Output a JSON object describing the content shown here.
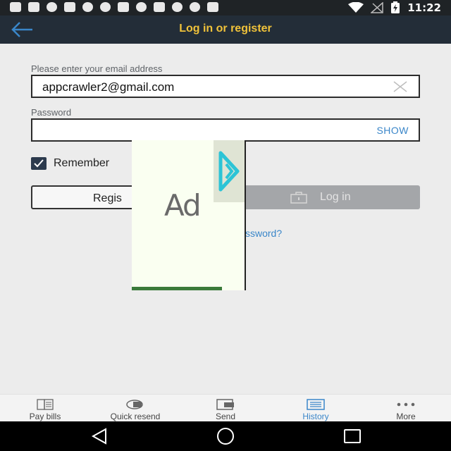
{
  "status_bar": {
    "time": "11:22",
    "notification_icons": [
      "chat-bubble-icon",
      "bat-icon",
      "link-icon",
      "bat-icon",
      "link-icon",
      "link-icon",
      "bat-icon",
      "b-bubble-icon",
      "mail-icon",
      "pinterest-icon",
      "cluster-icon",
      "e-icon"
    ],
    "system_icons": [
      "wifi-icon",
      "no-signal-icon",
      "battery-charging-icon"
    ]
  },
  "app_bar": {
    "title": "Log in or register",
    "back_icon": "arrow-left-icon",
    "colors": {
      "background": "#232d38",
      "title": "#f0c23a",
      "icon": "#3a86c9"
    }
  },
  "form": {
    "email": {
      "label": "Please enter your email address",
      "value": "appcrawler2@gmail.com",
      "clear_icon": "close-icon"
    },
    "password": {
      "label": "Password",
      "value": "",
      "show_label": "SHOW"
    },
    "remember": {
      "label": "Remember",
      "checked": true
    },
    "register_label": "Regis",
    "login_label": "Log in",
    "forgot_label": "ssword?"
  },
  "ad": {
    "text": "Ad",
    "badge_icon": "adchoices-icon"
  },
  "bottom_nav": {
    "items": [
      {
        "label": "Pay bills",
        "icon": "bills-icon",
        "active": false
      },
      {
        "label": "Quick resend",
        "icon": "quick-resend-icon",
        "active": false
      },
      {
        "label": "Send",
        "icon": "send-money-icon",
        "active": false
      },
      {
        "label": "History",
        "icon": "history-icon",
        "active": true
      },
      {
        "label": "More",
        "icon": "more-dots-icon",
        "active": false
      }
    ],
    "active_color": "#3a86c9"
  },
  "system_nav": {
    "buttons": [
      "back-triangle-icon",
      "home-circle-icon",
      "recents-square-icon"
    ]
  }
}
